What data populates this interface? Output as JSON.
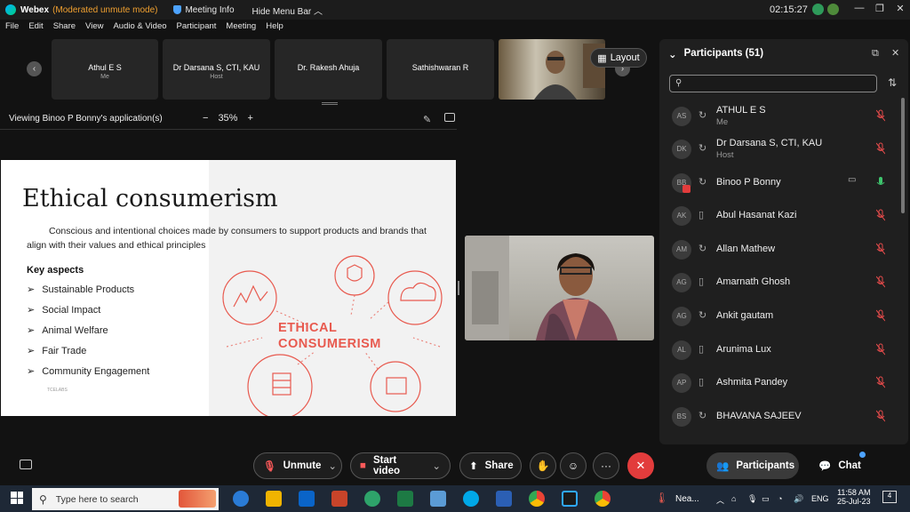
{
  "titlebar": {
    "app": "Webex",
    "mode": "(Moderated unmute mode)",
    "meeting_info": "Meeting Info",
    "hide_menu": "Hide Menu Bar",
    "time": "02:15:27"
  },
  "menu": [
    "File",
    "Edit",
    "Share",
    "View",
    "Audio & Video",
    "Participant",
    "Meeting",
    "Help"
  ],
  "strip": [
    {
      "name": "Athul E S",
      "role": "Me"
    },
    {
      "name": "Dr Darsana S, CTI, KAU",
      "role": "Host"
    },
    {
      "name": "Dr. Rakesh Ahuja",
      "role": ""
    },
    {
      "name": "Sathishwaran R",
      "role": ""
    }
  ],
  "layout_label": "Layout",
  "share": {
    "viewing": "Viewing Binoo P Bonny's application(s)",
    "zoom_minus": "−",
    "zoom": "35%",
    "zoom_plus": "+"
  },
  "slide": {
    "title": "Ethical consumerism",
    "description": "Conscious and intentional choices made by consumers to support products and brands that align with their values and ethical principles",
    "key_heading": "Key aspects",
    "key_points": [
      "Sustainable Products",
      "Social Impact",
      "Animal Welfare",
      "Fair Trade",
      "Community Engagement"
    ],
    "graphic_line1": "ETHICAL",
    "graphic_line2": "CONSUMERISM",
    "footnote": "TCELABS",
    "accent": "#e85a4f"
  },
  "participants": {
    "header": "Participants (51)",
    "list": [
      {
        "initials": "AS",
        "name": "ATHUL E S",
        "role": "Me",
        "device": "sync",
        "mic": "muted"
      },
      {
        "initials": "DK",
        "name": "Dr Darsana S, CTI, KAU",
        "role": "Host",
        "device": "sync",
        "mic": "muted"
      },
      {
        "initials": "BB",
        "name": "Binoo P Bonny",
        "role": "",
        "device": "sync",
        "mic": "active"
      },
      {
        "initials": "AK",
        "name": "Abul Hasanat Kazi",
        "role": "",
        "device": "phone",
        "mic": "muted"
      },
      {
        "initials": "AM",
        "name": "Allan Mathew",
        "role": "",
        "device": "sync",
        "mic": "muted"
      },
      {
        "initials": "AG",
        "name": "Amarnath Ghosh",
        "role": "",
        "device": "phone",
        "mic": "muted"
      },
      {
        "initials": "AG",
        "name": "Ankit gautam",
        "role": "",
        "device": "sync",
        "mic": "muted"
      },
      {
        "initials": "AL",
        "name": "Arunima Lux",
        "role": "",
        "device": "phone",
        "mic": "muted"
      },
      {
        "initials": "AP",
        "name": "Ashmita Pandey",
        "role": "",
        "device": "phone",
        "mic": "muted"
      },
      {
        "initials": "BS",
        "name": "BHAVANA SAJEEV",
        "role": "",
        "device": "sync",
        "mic": "muted"
      }
    ]
  },
  "controls": {
    "unmute": "Unmute",
    "start_video": "Start video",
    "share": "Share",
    "more": "···",
    "participants": "Participants",
    "chat": "Chat"
  },
  "taskbar": {
    "search_placeholder": "Type here to search",
    "weather": "Nea...",
    "lang": "ENG",
    "time": "11:58 AM",
    "date": "25-Jul-23",
    "notif": "4"
  }
}
